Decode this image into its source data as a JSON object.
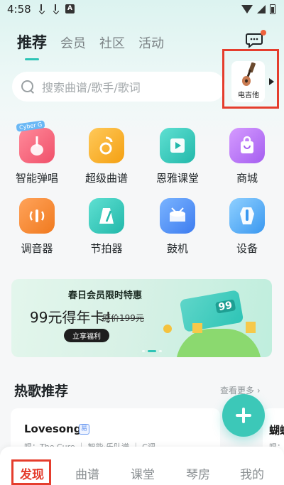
{
  "status_bar": {
    "time": "4:58"
  },
  "top_tabs": [
    {
      "label": "推荐",
      "active": true
    },
    {
      "label": "会员",
      "active": false
    },
    {
      "label": "社区",
      "active": false
    },
    {
      "label": "活动",
      "active": false
    }
  ],
  "search": {
    "placeholder": "搜索曲谱/歌手/歌词"
  },
  "instrument": {
    "label": "电吉他"
  },
  "features": [
    {
      "label": "智能弹唱",
      "badge": "Cyber G",
      "icon": "guitar-icon",
      "color": "#f05b6f"
    },
    {
      "label": "超级曲谱",
      "icon": "note-icon",
      "color": "#f4a623"
    },
    {
      "label": "恩雅课堂",
      "icon": "video-icon",
      "color": "#2ec4b6"
    },
    {
      "label": "商城",
      "icon": "shopping-bag-icon",
      "color": "#b06cf0"
    },
    {
      "label": "调音器",
      "icon": "tuner-icon",
      "color": "#f58a2c"
    },
    {
      "label": "节拍器",
      "icon": "metronome-icon",
      "color": "#2ec4b6"
    },
    {
      "label": "鼓机",
      "icon": "drum-icon",
      "color": "#4d8ff5"
    },
    {
      "label": "设备",
      "icon": "device-icon",
      "color": "#4da6f5"
    }
  ],
  "banner": {
    "subtitle": "春日会员限时特惠",
    "title": "99元得年卡！",
    "old_price": "原价199元",
    "cta": "立享福利",
    "card_number": "99"
  },
  "hot_songs": {
    "title": "热歌推荐",
    "more": "查看更多 ›",
    "items": [
      {
        "title": "Lovesong",
        "badge": "易",
        "meta": "唱：The Cure ｜ 智能·乐队谱 ｜ C调"
      },
      {
        "title": "蝴蝶",
        "meta": "唱："
      }
    ]
  },
  "bottom_nav": [
    {
      "label": "发现",
      "active": true
    },
    {
      "label": "曲谱",
      "active": false
    },
    {
      "label": "课堂",
      "active": false
    },
    {
      "label": "琴房",
      "active": false
    },
    {
      "label": "我的",
      "active": false
    }
  ],
  "colors": {
    "accent": "#2ec4b6",
    "highlight": "#e53d2d"
  }
}
